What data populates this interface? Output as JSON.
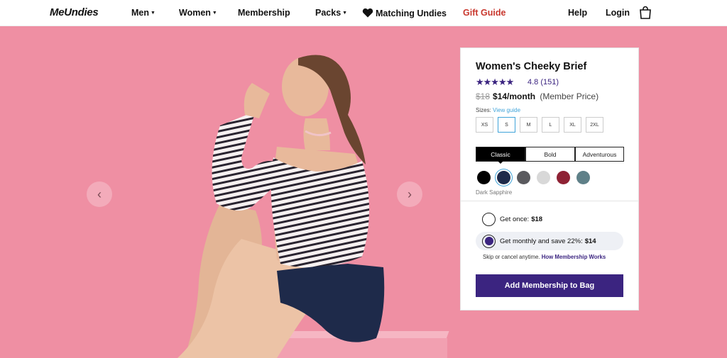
{
  "nav": {
    "logo": "MeUndies",
    "men": "Men",
    "women": "Women",
    "membership": "Membership",
    "packs": "Packs",
    "matching": "Matching Undies",
    "gift": "Gift Guide",
    "help": "Help",
    "login": "Login",
    "gift_color": "#c8372d"
  },
  "hero": {
    "background": "#ef8fa3",
    "prev_icon": "chevron-left-icon",
    "next_icon": "chevron-right-icon"
  },
  "product": {
    "title": "Women's Cheeky Brief",
    "stars": "★★★★★",
    "rating": "4.8",
    "reviews": "(151)",
    "old_price": "$18",
    "price": "$14/month",
    "price_note": "(Member Price)",
    "sizes_label": "Sizes:",
    "view_guide": "View guide",
    "sizes": [
      "XS",
      "S",
      "M",
      "L",
      "XL",
      "2XL"
    ],
    "selected_size": "S",
    "styles": [
      "Classic",
      "Bold",
      "Adventurous"
    ],
    "active_style": "Classic",
    "colors": [
      "#000000",
      "#1e2a4a",
      "#5a5a5e",
      "#d8d8d8",
      "#8e2234",
      "#5f8088"
    ],
    "selected_color_name": "Dark Sapphire",
    "once_label": "Get once:",
    "once_price": "$18",
    "monthly_label": "Get monthly and save 22%:",
    "monthly_price": "$14",
    "skip_text": "Skip or cancel anytime.",
    "how_link": "How Membership Works",
    "cta": "Add Membership to Bag",
    "accent": "#3b2480"
  }
}
